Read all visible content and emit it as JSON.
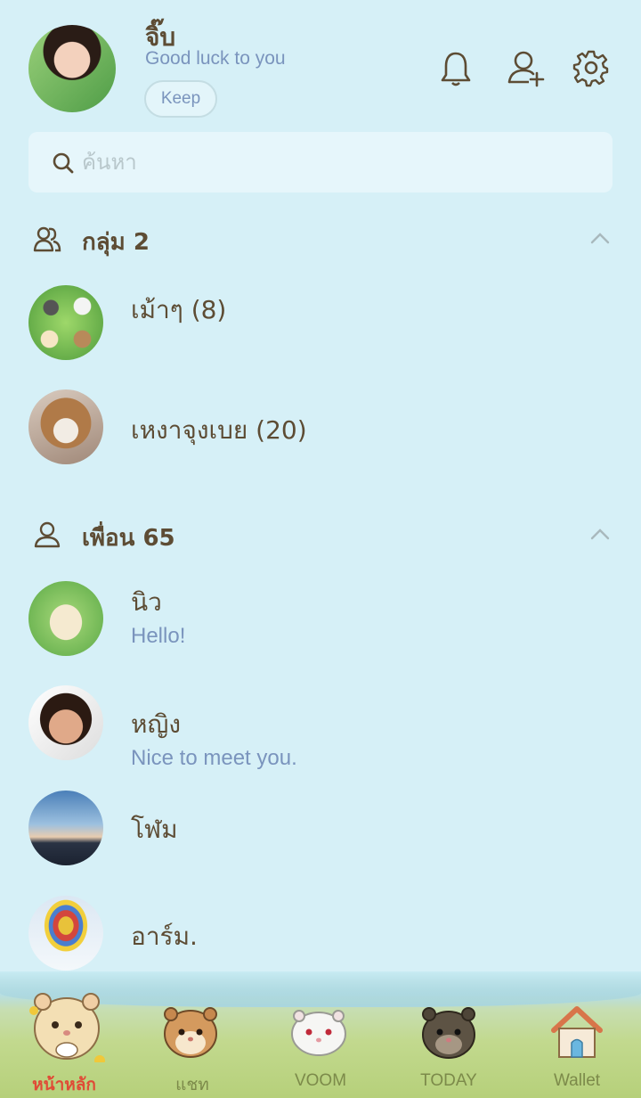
{
  "profile": {
    "name": "จิ๊บ",
    "status": "Good luck to you",
    "keep_label": "Keep"
  },
  "header_icons": [
    "bell-icon",
    "add-friend-icon",
    "gear-icon"
  ],
  "search": {
    "placeholder": "ค้นหา"
  },
  "groups": {
    "title": "กลุ่ม 2",
    "items": [
      {
        "name": "เม้าๆ (8)"
      },
      {
        "name": "เหงาจุงเบย (20)"
      }
    ]
  },
  "friends": {
    "title": "เพื่อน 65",
    "items": [
      {
        "name": "นิว",
        "status": "Hello!"
      },
      {
        "name": "หญิง",
        "status": "Nice to meet you."
      },
      {
        "name": "โฬม",
        "status": ""
      },
      {
        "name": "อาร์ม.",
        "status": ""
      }
    ]
  },
  "nav": {
    "items": [
      {
        "label": "หน้าหลัก",
        "icon": "hamster-home-icon",
        "active": true
      },
      {
        "label": "แชท",
        "icon": "hamster-chat-icon",
        "active": false
      },
      {
        "label": "VOOM",
        "icon": "hamster-voom-icon",
        "active": false
      },
      {
        "label": "TODAY",
        "icon": "hamster-today-icon",
        "active": false
      },
      {
        "label": "Wallet",
        "icon": "house-wallet-icon",
        "active": false
      }
    ]
  },
  "colors": {
    "background": "#d6f0f7",
    "text": "#5d4c34",
    "status_text": "#7a94bd",
    "active_nav": "#e04b36"
  }
}
